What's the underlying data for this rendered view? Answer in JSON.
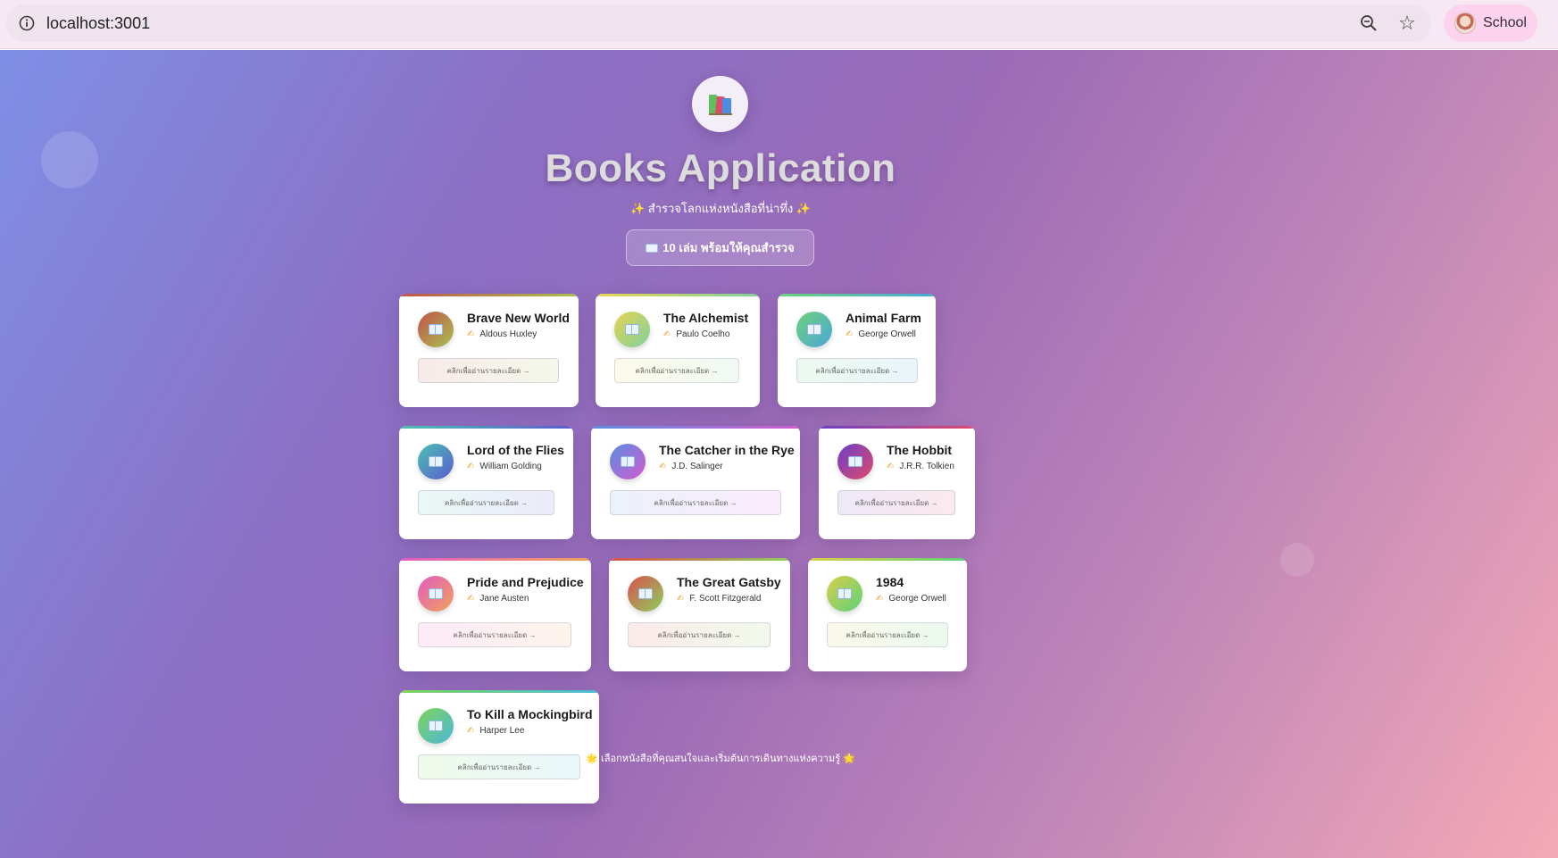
{
  "browser": {
    "url": "localhost:3001",
    "profile_label": "School",
    "icons": [
      "info-icon",
      "zoom-out-icon",
      "star-icon",
      "profile-avatar"
    ]
  },
  "header": {
    "logo_icon": "books-icon",
    "title": "Books Application",
    "subtitle_left_icon": "✨",
    "subtitle": "สำรวจโลกแห่งหนังสือที่น่าทึ่ง",
    "subtitle_right_icon": "✨",
    "count_label": "10 เล่ม พร้อมให้คุณสำรวจ"
  },
  "books": [
    {
      "title": "Brave New World",
      "author": "Aldous Huxley",
      "button": "คลิกเพื่ออ่านรายละเอียด →",
      "colors": [
        "#c0534a",
        "#a9c04f"
      ]
    },
    {
      "title": "The Alchemist",
      "author": "Paulo Coelho",
      "button": "คลิกเพื่ออ่านรายละเอียด →",
      "colors": [
        "#e6d452",
        "#7fd19c"
      ]
    },
    {
      "title": "Animal Farm",
      "author": "George Orwell",
      "button": "คลิกเพื่ออ่านรายละเอียด →",
      "colors": [
        "#6ed07a",
        "#4aa8d8"
      ]
    },
    {
      "title": "Lord of the Flies",
      "author": "William Golding",
      "button": "คลิกเพื่ออ่านรายละเอียด →",
      "colors": [
        "#4cc2b0",
        "#5b5bd1"
      ]
    },
    {
      "title": "The Catcher in the Rye",
      "author": "J.D. Salinger",
      "button": "คลิกเพื่ออ่านรายละเอียด →",
      "colors": [
        "#5a8ee0",
        "#d25ad0"
      ]
    },
    {
      "title": "The Hobbit",
      "author": "J.R.R. Tolkien",
      "button": "คลิกเพื่ออ่านรายละเอียด →",
      "colors": [
        "#6a3fc9",
        "#e04a6a"
      ]
    },
    {
      "title": "Pride and Prejudice",
      "author": "Jane Austen",
      "button": "คลิกเพื่ออ่านรายละเอียด →",
      "colors": [
        "#e25bc2",
        "#f0a25a"
      ]
    },
    {
      "title": "The Great Gatsby",
      "author": "F. Scott Fitzgerald",
      "button": "คลิกเพื่ออ่านรายละเอียด →",
      "colors": [
        "#d9504e",
        "#8ccf5c"
      ]
    },
    {
      "title": "1984",
      "author": "George Orwell",
      "button": "คลิกเพื่ออ่านรายละเอียด →",
      "colors": [
        "#d8cf4a",
        "#5fd07a"
      ]
    },
    {
      "title": "To Kill a Mockingbird",
      "author": "Harper Lee",
      "button": "คลิกเพื่ออ่านรายละเอียด →",
      "colors": [
        "#7fd45a",
        "#4ab8d8"
      ]
    }
  ],
  "footer": {
    "left_icon": "🌟",
    "text": "เลือกหนังสือที่คุณสนใจและเริ่มต้นการเดินทางแห่งความรู้",
    "right_icon": "🌟"
  }
}
